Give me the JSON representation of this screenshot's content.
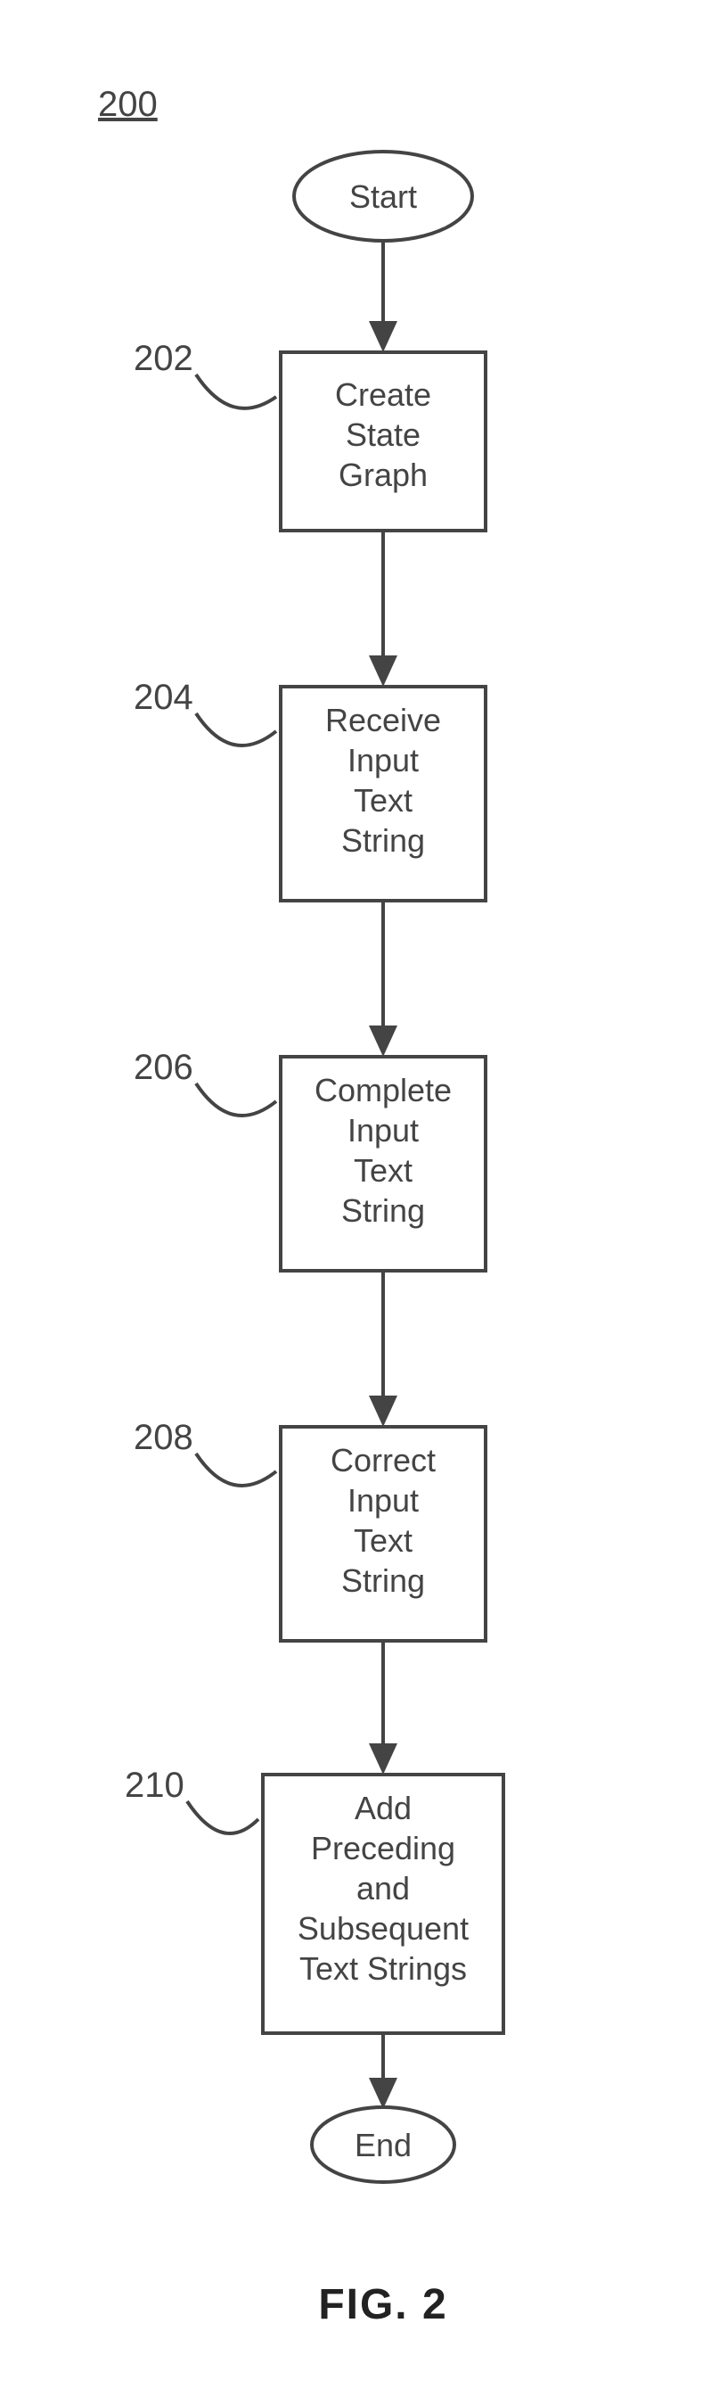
{
  "chart_data": {
    "type": "flowchart",
    "title": "200",
    "figure_label": "FIG. 2",
    "nodes": [
      {
        "id": "start",
        "kind": "terminator",
        "text": "Start"
      },
      {
        "id": "n202",
        "kind": "process",
        "ref": "202",
        "lines": [
          "Create",
          "State",
          "Graph"
        ]
      },
      {
        "id": "n204",
        "kind": "process",
        "ref": "204",
        "lines": [
          "Receive",
          "Input",
          "Text",
          "String"
        ]
      },
      {
        "id": "n206",
        "kind": "process",
        "ref": "206",
        "lines": [
          "Complete",
          "Input",
          "Text",
          "String"
        ]
      },
      {
        "id": "n208",
        "kind": "process",
        "ref": "208",
        "lines": [
          "Correct",
          "Input",
          "Text",
          "String"
        ]
      },
      {
        "id": "n210",
        "kind": "process",
        "ref": "210",
        "lines": [
          "Add",
          "Preceding",
          "and",
          "Subsequent",
          "Text Strings"
        ]
      },
      {
        "id": "end",
        "kind": "terminator",
        "text": "End"
      }
    ],
    "edges": [
      [
        "start",
        "n202"
      ],
      [
        "n202",
        "n204"
      ],
      [
        "n204",
        "n206"
      ],
      [
        "n206",
        "n208"
      ],
      [
        "n208",
        "n210"
      ],
      [
        "n210",
        "end"
      ]
    ]
  }
}
